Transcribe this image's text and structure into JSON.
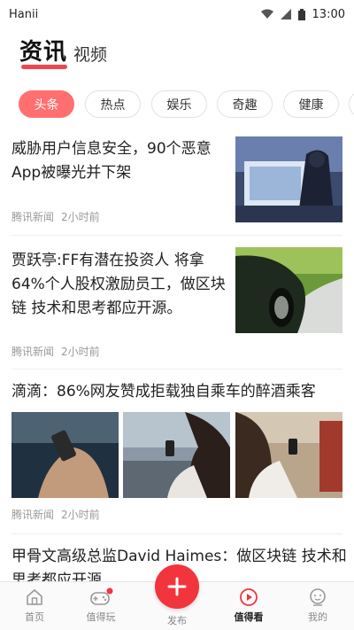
{
  "status_bar": {
    "carrier": "Hanii",
    "time": "13:00"
  },
  "header": {
    "title": "资讯",
    "subtitle": "视频"
  },
  "tabs": [
    "头条",
    "热点",
    "娱乐",
    "奇趣",
    "健康"
  ],
  "articles": [
    {
      "title": "威胁用户信息安全，90个恶意App被曝光并下架",
      "source": "腾讯新闻",
      "time": "2小时前"
    },
    {
      "title": "贾跃亭:FF有潜在投资人 将拿64%个人股权激励员工，做区块链 技术和思考都应开源。",
      "source": "腾讯新闻",
      "time": "2小时前"
    },
    {
      "title": "滴滴：86%网友赞成拒载独自乘车的醉酒乘客",
      "source": "腾讯新闻",
      "time": "2小时前"
    },
    {
      "title": "甲骨文高级总监David Haimes：做区块链 技术和思考都应开源"
    }
  ],
  "tabbar": {
    "home": "首页",
    "play": "值得玩",
    "publish": "发布",
    "watch": "值得看",
    "mine": "我的"
  },
  "colors": {
    "accent": "#f0454e",
    "active_tab": "#ff6f6f",
    "publish": "#f2343c"
  },
  "icons": [
    "wifi-icon",
    "signal-icon",
    "battery-icon",
    "home-icon",
    "gamepad-icon",
    "plus-icon",
    "play-circle-icon",
    "profile-icon"
  ]
}
